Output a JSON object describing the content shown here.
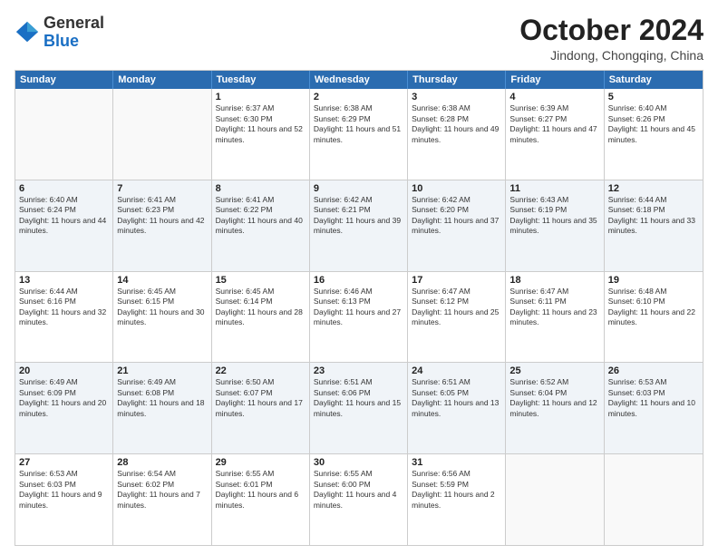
{
  "header": {
    "logo": {
      "general": "General",
      "blue": "Blue"
    },
    "title": "October 2024",
    "location": "Jindong, Chongqing, China"
  },
  "calendar": {
    "days": [
      "Sunday",
      "Monday",
      "Tuesday",
      "Wednesday",
      "Thursday",
      "Friday",
      "Saturday"
    ],
    "rows": [
      [
        {
          "day": "",
          "empty": true
        },
        {
          "day": "",
          "empty": true
        },
        {
          "day": "1",
          "sunrise": "6:37 AM",
          "sunset": "6:30 PM",
          "daylight": "11 hours and 52 minutes."
        },
        {
          "day": "2",
          "sunrise": "6:38 AM",
          "sunset": "6:29 PM",
          "daylight": "11 hours and 51 minutes."
        },
        {
          "day": "3",
          "sunrise": "6:38 AM",
          "sunset": "6:28 PM",
          "daylight": "11 hours and 49 minutes."
        },
        {
          "day": "4",
          "sunrise": "6:39 AM",
          "sunset": "6:27 PM",
          "daylight": "11 hours and 47 minutes."
        },
        {
          "day": "5",
          "sunrise": "6:40 AM",
          "sunset": "6:26 PM",
          "daylight": "11 hours and 45 minutes."
        }
      ],
      [
        {
          "day": "6",
          "sunrise": "6:40 AM",
          "sunset": "6:24 PM",
          "daylight": "11 hours and 44 minutes."
        },
        {
          "day": "7",
          "sunrise": "6:41 AM",
          "sunset": "6:23 PM",
          "daylight": "11 hours and 42 minutes."
        },
        {
          "day": "8",
          "sunrise": "6:41 AM",
          "sunset": "6:22 PM",
          "daylight": "11 hours and 40 minutes."
        },
        {
          "day": "9",
          "sunrise": "6:42 AM",
          "sunset": "6:21 PM",
          "daylight": "11 hours and 39 minutes."
        },
        {
          "day": "10",
          "sunrise": "6:42 AM",
          "sunset": "6:20 PM",
          "daylight": "11 hours and 37 minutes."
        },
        {
          "day": "11",
          "sunrise": "6:43 AM",
          "sunset": "6:19 PM",
          "daylight": "11 hours and 35 minutes."
        },
        {
          "day": "12",
          "sunrise": "6:44 AM",
          "sunset": "6:18 PM",
          "daylight": "11 hours and 33 minutes."
        }
      ],
      [
        {
          "day": "13",
          "sunrise": "6:44 AM",
          "sunset": "6:16 PM",
          "daylight": "11 hours and 32 minutes."
        },
        {
          "day": "14",
          "sunrise": "6:45 AM",
          "sunset": "6:15 PM",
          "daylight": "11 hours and 30 minutes."
        },
        {
          "day": "15",
          "sunrise": "6:45 AM",
          "sunset": "6:14 PM",
          "daylight": "11 hours and 28 minutes."
        },
        {
          "day": "16",
          "sunrise": "6:46 AM",
          "sunset": "6:13 PM",
          "daylight": "11 hours and 27 minutes."
        },
        {
          "day": "17",
          "sunrise": "6:47 AM",
          "sunset": "6:12 PM",
          "daylight": "11 hours and 25 minutes."
        },
        {
          "day": "18",
          "sunrise": "6:47 AM",
          "sunset": "6:11 PM",
          "daylight": "11 hours and 23 minutes."
        },
        {
          "day": "19",
          "sunrise": "6:48 AM",
          "sunset": "6:10 PM",
          "daylight": "11 hours and 22 minutes."
        }
      ],
      [
        {
          "day": "20",
          "sunrise": "6:49 AM",
          "sunset": "6:09 PM",
          "daylight": "11 hours and 20 minutes."
        },
        {
          "day": "21",
          "sunrise": "6:49 AM",
          "sunset": "6:08 PM",
          "daylight": "11 hours and 18 minutes."
        },
        {
          "day": "22",
          "sunrise": "6:50 AM",
          "sunset": "6:07 PM",
          "daylight": "11 hours and 17 minutes."
        },
        {
          "day": "23",
          "sunrise": "6:51 AM",
          "sunset": "6:06 PM",
          "daylight": "11 hours and 15 minutes."
        },
        {
          "day": "24",
          "sunrise": "6:51 AM",
          "sunset": "6:05 PM",
          "daylight": "11 hours and 13 minutes."
        },
        {
          "day": "25",
          "sunrise": "6:52 AM",
          "sunset": "6:04 PM",
          "daylight": "11 hours and 12 minutes."
        },
        {
          "day": "26",
          "sunrise": "6:53 AM",
          "sunset": "6:03 PM",
          "daylight": "11 hours and 10 minutes."
        }
      ],
      [
        {
          "day": "27",
          "sunrise": "6:53 AM",
          "sunset": "6:03 PM",
          "daylight": "11 hours and 9 minutes."
        },
        {
          "day": "28",
          "sunrise": "6:54 AM",
          "sunset": "6:02 PM",
          "daylight": "11 hours and 7 minutes."
        },
        {
          "day": "29",
          "sunrise": "6:55 AM",
          "sunset": "6:01 PM",
          "daylight": "11 hours and 6 minutes."
        },
        {
          "day": "30",
          "sunrise": "6:55 AM",
          "sunset": "6:00 PM",
          "daylight": "11 hours and 4 minutes."
        },
        {
          "day": "31",
          "sunrise": "6:56 AM",
          "sunset": "5:59 PM",
          "daylight": "11 hours and 2 minutes."
        },
        {
          "day": "",
          "empty": true
        },
        {
          "day": "",
          "empty": true
        }
      ]
    ]
  }
}
